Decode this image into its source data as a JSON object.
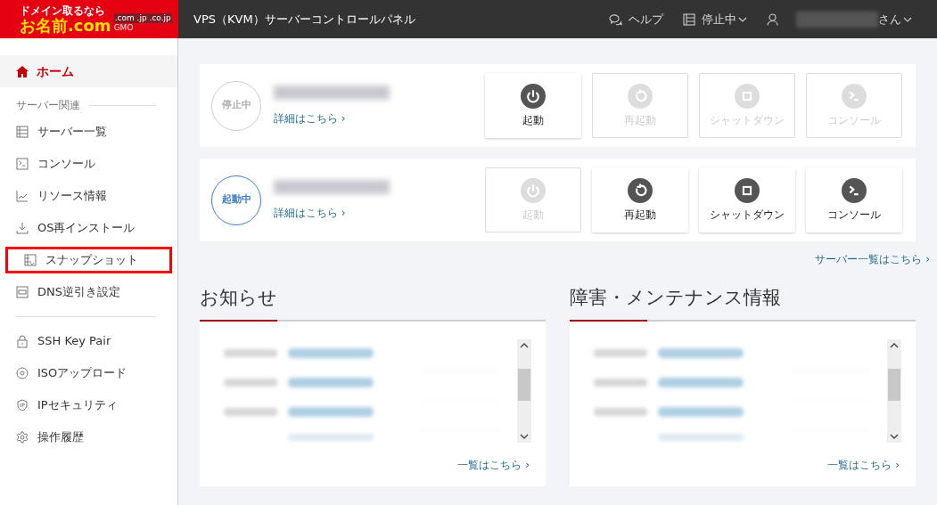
{
  "logo": {
    "tagline": "ドメイン取るなら",
    "name": "お名前.com",
    "domains": ".com .jp .co.jp",
    "brand": "GMO"
  },
  "header": {
    "title": "VPS（KVM）サーバーコントロールパネル",
    "help": "ヘルプ",
    "server_status": "停止中",
    "user_suffix": "さん"
  },
  "sidebar": {
    "home": {
      "label": "ホーム",
      "selected": true
    },
    "section_heading": "サーバー関連",
    "items": [
      {
        "label": "サーバー一覧",
        "kind": "list",
        "highlighted": false
      },
      {
        "label": "コンソール",
        "kind": "console",
        "highlighted": false
      },
      {
        "label": "リソース情報",
        "kind": "chart",
        "highlighted": false
      },
      {
        "label": "OS再インストール",
        "kind": "download",
        "highlighted": false
      },
      {
        "label": "スナップショット",
        "kind": "snapshot",
        "highlighted": true
      },
      {
        "label": "DNS逆引き設定",
        "kind": "dns",
        "highlighted": false
      }
    ],
    "items_2": [
      {
        "label": "SSH Key Pair",
        "kind": "lock"
      },
      {
        "label": "ISOアップロード",
        "kind": "disc"
      },
      {
        "label": "IPセキュリティ",
        "kind": "shield"
      },
      {
        "label": "操作履歴",
        "kind": "gear"
      }
    ]
  },
  "servers": [
    {
      "status": "停止中",
      "running": false,
      "details_link": "詳細はこちら ›",
      "actions": [
        {
          "label": "起動",
          "kind": "power",
          "disabled": false
        },
        {
          "label": "再起動",
          "kind": "restart",
          "disabled": true
        },
        {
          "label": "シャットダウン",
          "kind": "shutdown",
          "disabled": true
        },
        {
          "label": "コンソール",
          "kind": "console",
          "disabled": true
        }
      ]
    },
    {
      "status": "起動中",
      "running": true,
      "details_link": "詳細はこちら ›",
      "actions": [
        {
          "label": "起動",
          "kind": "power",
          "disabled": true
        },
        {
          "label": "再起動",
          "kind": "restart",
          "disabled": false
        },
        {
          "label": "シャットダウン",
          "kind": "shutdown",
          "disabled": false
        },
        {
          "label": "コンソール",
          "kind": "console",
          "disabled": false
        }
      ]
    }
  ],
  "server_list_link": "サーバー一覧はこちら ›",
  "panels": [
    {
      "title": "お知らせ",
      "more_link": "一覧はこちら ›"
    },
    {
      "title": "障害・メンテナンス情報",
      "more_link": "一覧はこちら ›"
    }
  ]
}
